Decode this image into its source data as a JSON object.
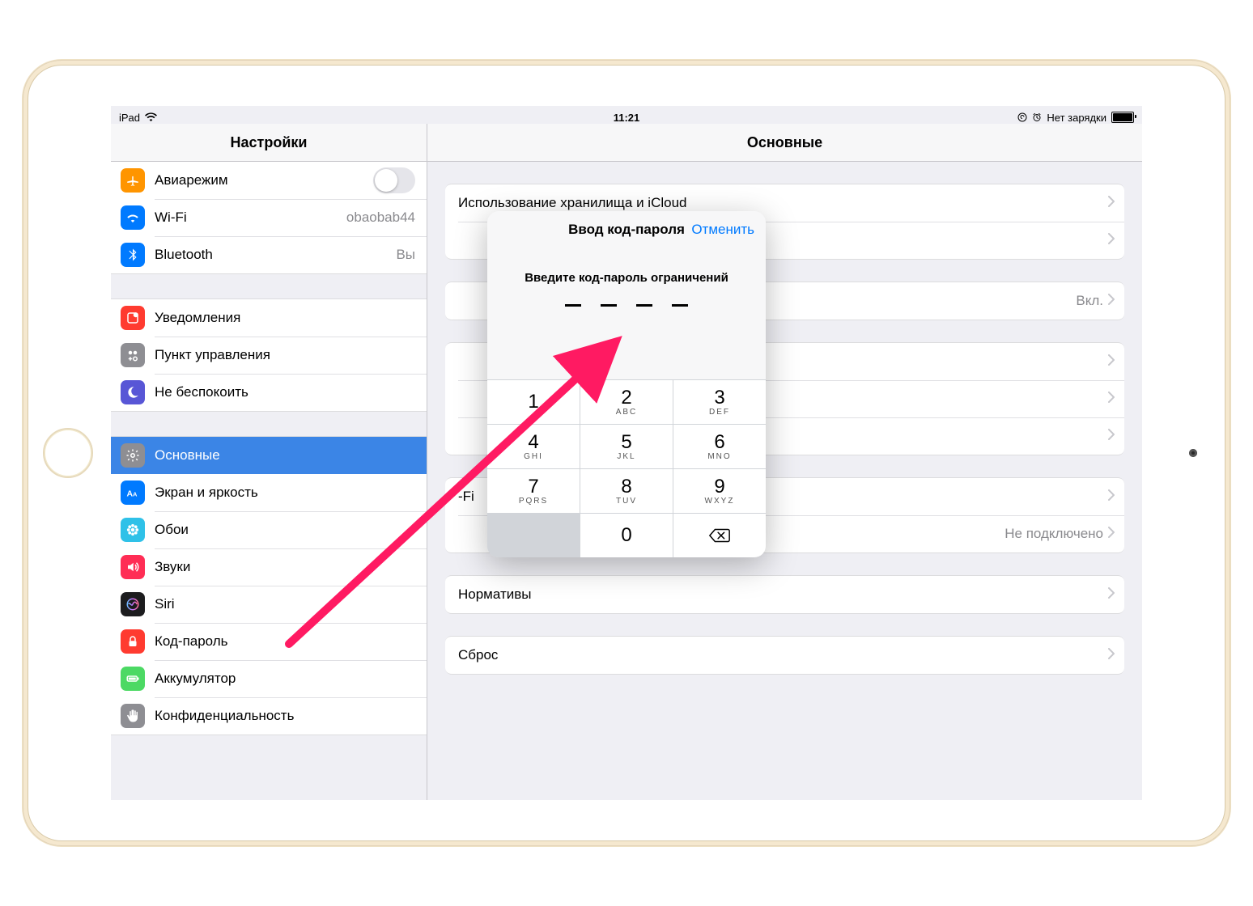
{
  "status": {
    "device": "iPad",
    "time": "11:21",
    "charge_text": "Нет зарядки"
  },
  "sidebar": {
    "title": "Настройки",
    "groups": [
      [
        {
          "label": "Авиарежим",
          "icon": "airplane",
          "color": "#ff9500",
          "toggle": true
        },
        {
          "label": "Wi-Fi",
          "icon": "wifi",
          "color": "#007aff",
          "value": "obaobab44"
        },
        {
          "label": "Bluetooth",
          "icon": "bluetooth",
          "color": "#007aff",
          "value": "Вы"
        }
      ],
      [
        {
          "label": "Уведомления",
          "icon": "notify",
          "color": "#ff3b30"
        },
        {
          "label": "Пункт управления",
          "icon": "control",
          "color": "#8e8e93"
        },
        {
          "label": "Не беспокоить",
          "icon": "moon",
          "color": "#5856d6"
        }
      ],
      [
        {
          "label": "Основные",
          "icon": "gear",
          "color": "#8e8e93",
          "selected": true
        },
        {
          "label": "Экран и яркость",
          "icon": "display",
          "color": "#007aff"
        },
        {
          "label": "Обои",
          "icon": "flower",
          "color": "#2fc1e8"
        },
        {
          "label": "Звуки",
          "icon": "speaker",
          "color": "#ff2d55"
        },
        {
          "label": "Siri",
          "icon": "siri",
          "color": "#1c1c1e"
        },
        {
          "label": "Код-пароль",
          "icon": "lock",
          "color": "#ff3b30"
        },
        {
          "label": "Аккумулятор",
          "icon": "battery",
          "color": "#4cd964"
        },
        {
          "label": "Конфиденциальность",
          "icon": "hand",
          "color": "#8e8e93"
        }
      ]
    ]
  },
  "detail": {
    "title": "Основные",
    "groups": [
      [
        {
          "label": "Использование хранилища и iCloud"
        },
        {
          "label": ""
        }
      ],
      [
        {
          "label": "",
          "value": "Вкл."
        }
      ],
      [
        {
          "label": ""
        },
        {
          "label": ""
        },
        {
          "label": ""
        }
      ],
      [
        {
          "label": "-Fi"
        },
        {
          "label": "",
          "value": "Не подключено"
        }
      ],
      [
        {
          "label": "Нормативы"
        }
      ],
      [
        {
          "label": "Сброс"
        }
      ]
    ]
  },
  "modal": {
    "title": "Ввод код-пароля",
    "cancel": "Отменить",
    "prompt": "Введите код-пароль ограничений",
    "keys": [
      {
        "d": "1",
        "s": ""
      },
      {
        "d": "2",
        "s": "ABC"
      },
      {
        "d": "3",
        "s": "DEF"
      },
      {
        "d": "4",
        "s": "GHI"
      },
      {
        "d": "5",
        "s": "JKL"
      },
      {
        "d": "6",
        "s": "MNO"
      },
      {
        "d": "7",
        "s": "PQRS"
      },
      {
        "d": "8",
        "s": "TUV"
      },
      {
        "d": "9",
        "s": "WXYZ"
      },
      {
        "d": "",
        "blank": true
      },
      {
        "d": "0",
        "s": ""
      },
      {
        "d": "",
        "del": true
      }
    ]
  }
}
